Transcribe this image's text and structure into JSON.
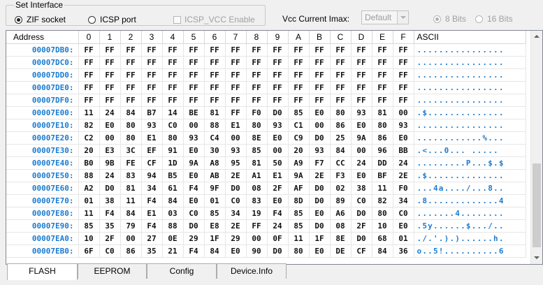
{
  "interface": {
    "group_title": "Set Interface",
    "zif_label": "ZIF socket",
    "icsp_label": "ICSP port",
    "icsp_vcc_label": "ICSP_VCC Enable",
    "vcc_label": "Vcc Current Imax:",
    "vcc_value": "Default",
    "bits8_label": "8 Bits",
    "bits16_label": "16 Bits"
  },
  "grid": {
    "address_header": "Address",
    "ascii_header": "ASCII",
    "columns": [
      "0",
      "1",
      "2",
      "3",
      "4",
      "5",
      "6",
      "7",
      "8",
      "9",
      "A",
      "B",
      "C",
      "D",
      "E",
      "F"
    ],
    "rows": [
      {
        "addr": "00007DB0:",
        "bytes": [
          "FF",
          "FF",
          "FF",
          "FF",
          "FF",
          "FF",
          "FF",
          "FF",
          "FF",
          "FF",
          "FF",
          "FF",
          "FF",
          "FF",
          "FF",
          "FF"
        ],
        "ascii": "................"
      },
      {
        "addr": "00007DC0:",
        "bytes": [
          "FF",
          "FF",
          "FF",
          "FF",
          "FF",
          "FF",
          "FF",
          "FF",
          "FF",
          "FF",
          "FF",
          "FF",
          "FF",
          "FF",
          "FF",
          "FF"
        ],
        "ascii": "................"
      },
      {
        "addr": "00007DD0:",
        "bytes": [
          "FF",
          "FF",
          "FF",
          "FF",
          "FF",
          "FF",
          "FF",
          "FF",
          "FF",
          "FF",
          "FF",
          "FF",
          "FF",
          "FF",
          "FF",
          "FF"
        ],
        "ascii": "................"
      },
      {
        "addr": "00007DE0:",
        "bytes": [
          "FF",
          "FF",
          "FF",
          "FF",
          "FF",
          "FF",
          "FF",
          "FF",
          "FF",
          "FF",
          "FF",
          "FF",
          "FF",
          "FF",
          "FF",
          "FF"
        ],
        "ascii": "................"
      },
      {
        "addr": "00007DF0:",
        "bytes": [
          "FF",
          "FF",
          "FF",
          "FF",
          "FF",
          "FF",
          "FF",
          "FF",
          "FF",
          "FF",
          "FF",
          "FF",
          "FF",
          "FF",
          "FF",
          "FF"
        ],
        "ascii": "................"
      },
      {
        "addr": "00007E00:",
        "bytes": [
          "11",
          "24",
          "84",
          "B7",
          "14",
          "BE",
          "81",
          "FF",
          "F0",
          "D0",
          "85",
          "E0",
          "80",
          "93",
          "81",
          "00"
        ],
        "ascii": ".$.............."
      },
      {
        "addr": "00007E10:",
        "bytes": [
          "82",
          "E0",
          "80",
          "93",
          "C0",
          "00",
          "88",
          "E1",
          "80",
          "93",
          "C1",
          "00",
          "86",
          "E0",
          "80",
          "93"
        ],
        "ascii": "................"
      },
      {
        "addr": "00007E20:",
        "bytes": [
          "C2",
          "00",
          "80",
          "E1",
          "80",
          "93",
          "C4",
          "00",
          "8E",
          "E0",
          "C9",
          "D0",
          "25",
          "9A",
          "86",
          "E0"
        ],
        "ascii": "............%..."
      },
      {
        "addr": "00007E30:",
        "bytes": [
          "20",
          "E3",
          "3C",
          "EF",
          "91",
          "E0",
          "30",
          "93",
          "85",
          "00",
          "20",
          "93",
          "84",
          "00",
          "96",
          "BB"
        ],
        "ascii": " .<...0... ....."
      },
      {
        "addr": "00007E40:",
        "bytes": [
          "B0",
          "9B",
          "FE",
          "CF",
          "1D",
          "9A",
          "A8",
          "95",
          "81",
          "50",
          "A9",
          "F7",
          "CC",
          "24",
          "DD",
          "24"
        ],
        "ascii": ".........P...$.$"
      },
      {
        "addr": "00007E50:",
        "bytes": [
          "88",
          "24",
          "83",
          "94",
          "B5",
          "E0",
          "AB",
          "2E",
          "A1",
          "E1",
          "9A",
          "2E",
          "F3",
          "E0",
          "BF",
          "2E"
        ],
        "ascii": ".$.............."
      },
      {
        "addr": "00007E60:",
        "bytes": [
          "A2",
          "D0",
          "81",
          "34",
          "61",
          "F4",
          "9F",
          "D0",
          "08",
          "2F",
          "AF",
          "D0",
          "02",
          "38",
          "11",
          "F0"
        ],
        "ascii": "...4a..../...8.."
      },
      {
        "addr": "00007E70:",
        "bytes": [
          "01",
          "38",
          "11",
          "F4",
          "84",
          "E0",
          "01",
          "C0",
          "83",
          "E0",
          "8D",
          "D0",
          "89",
          "C0",
          "82",
          "34"
        ],
        "ascii": ".8.............4"
      },
      {
        "addr": "00007E80:",
        "bytes": [
          "11",
          "F4",
          "84",
          "E1",
          "03",
          "C0",
          "85",
          "34",
          "19",
          "F4",
          "85",
          "E0",
          "A6",
          "D0",
          "80",
          "C0"
        ],
        "ascii": ".......4........"
      },
      {
        "addr": "00007E90:",
        "bytes": [
          "85",
          "35",
          "79",
          "F4",
          "88",
          "D0",
          "E8",
          "2E",
          "FF",
          "24",
          "85",
          "D0",
          "08",
          "2F",
          "10",
          "E0"
        ],
        "ascii": ".5y......$.../.."
      },
      {
        "addr": "00007EA0:",
        "bytes": [
          "10",
          "2F",
          "00",
          "27",
          "0E",
          "29",
          "1F",
          "29",
          "00",
          "0F",
          "11",
          "1F",
          "8E",
          "D0",
          "68",
          "01"
        ],
        "ascii": "./.'.).)......h."
      },
      {
        "addr": "00007EB0:",
        "bytes": [
          "6F",
          "C0",
          "86",
          "35",
          "21",
          "F4",
          "84",
          "E0",
          "90",
          "D0",
          "80",
          "E0",
          "DE",
          "CF",
          "84",
          "36"
        ],
        "ascii": "o..5!..........6"
      }
    ]
  },
  "tabs": [
    {
      "label": "FLASH",
      "active": true
    },
    {
      "label": "EEPROM",
      "active": false
    },
    {
      "label": "Config",
      "active": false
    },
    {
      "label": "Device.Info",
      "active": false
    }
  ]
}
